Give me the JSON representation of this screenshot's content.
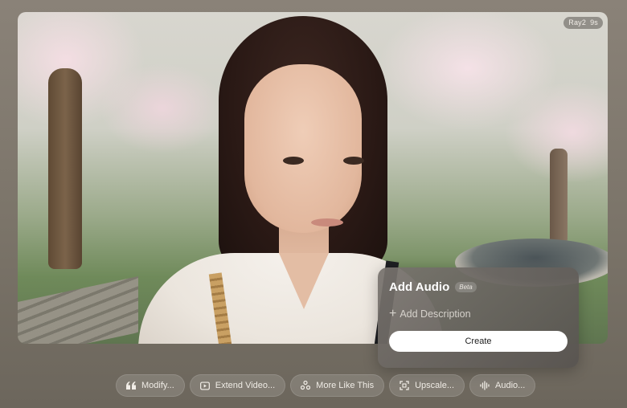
{
  "video": {
    "badge_model": "Ray2",
    "badge_duration": "9s"
  },
  "audio_panel": {
    "title": "Add Audio",
    "beta_label": "Beta",
    "add_description_label": "Add Description",
    "create_label": "Create"
  },
  "actions": [
    {
      "label": "Modify...",
      "icon": "quote-icon"
    },
    {
      "label": "Extend Video...",
      "icon": "extend-video-icon"
    },
    {
      "label": "More Like This",
      "icon": "more-like-this-icon"
    },
    {
      "label": "Upscale...",
      "icon": "upscale-icon"
    },
    {
      "label": "Audio...",
      "icon": "audio-waveform-icon"
    }
  ],
  "colors": {
    "panel_bg": "#6e6a66",
    "create_button": "#ffffff",
    "chip_bg": "rgba(255,255,255,0.14)"
  }
}
